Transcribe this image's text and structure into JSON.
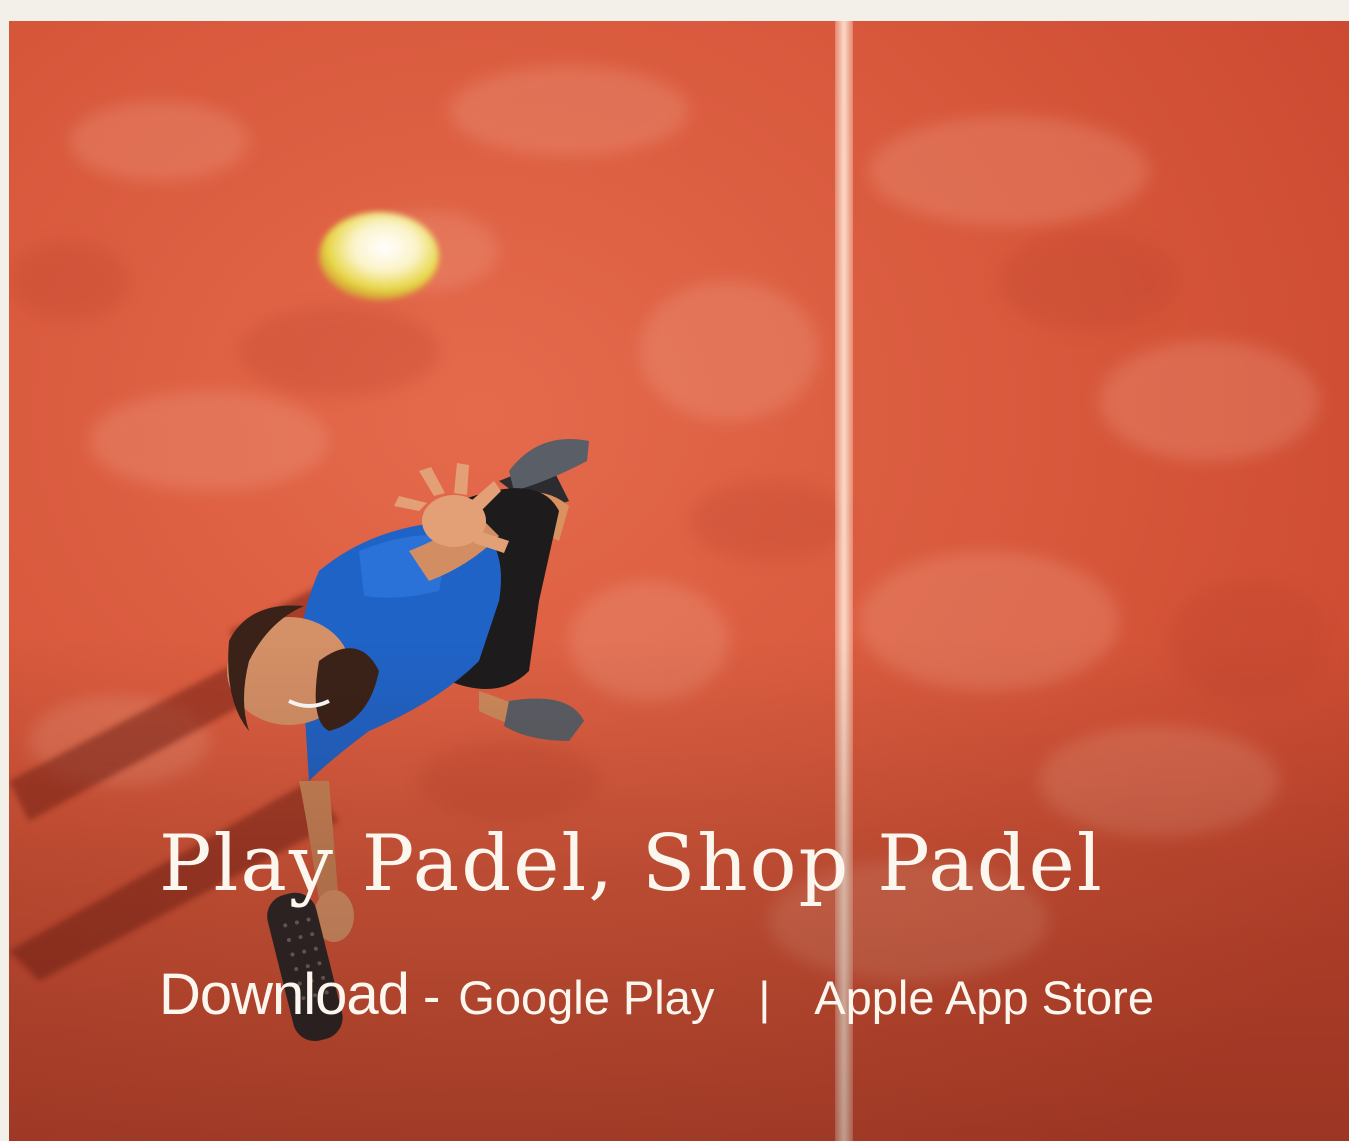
{
  "hero": {
    "headline": "Play Padel, Shop Padel",
    "download_label": "Download",
    "dash": "-",
    "separator": "|",
    "links": {
      "google_play": "Google Play",
      "apple_app_store": "Apple App Store"
    }
  },
  "colors": {
    "page_background": "#f3f0ea",
    "court_orange": "#d8553a",
    "text": "#fbf6ee",
    "shirt_blue": "#1f63c7"
  },
  "icons": {
    "ball": "padel-ball",
    "player": "padel-player",
    "racket": "padel-racket"
  }
}
